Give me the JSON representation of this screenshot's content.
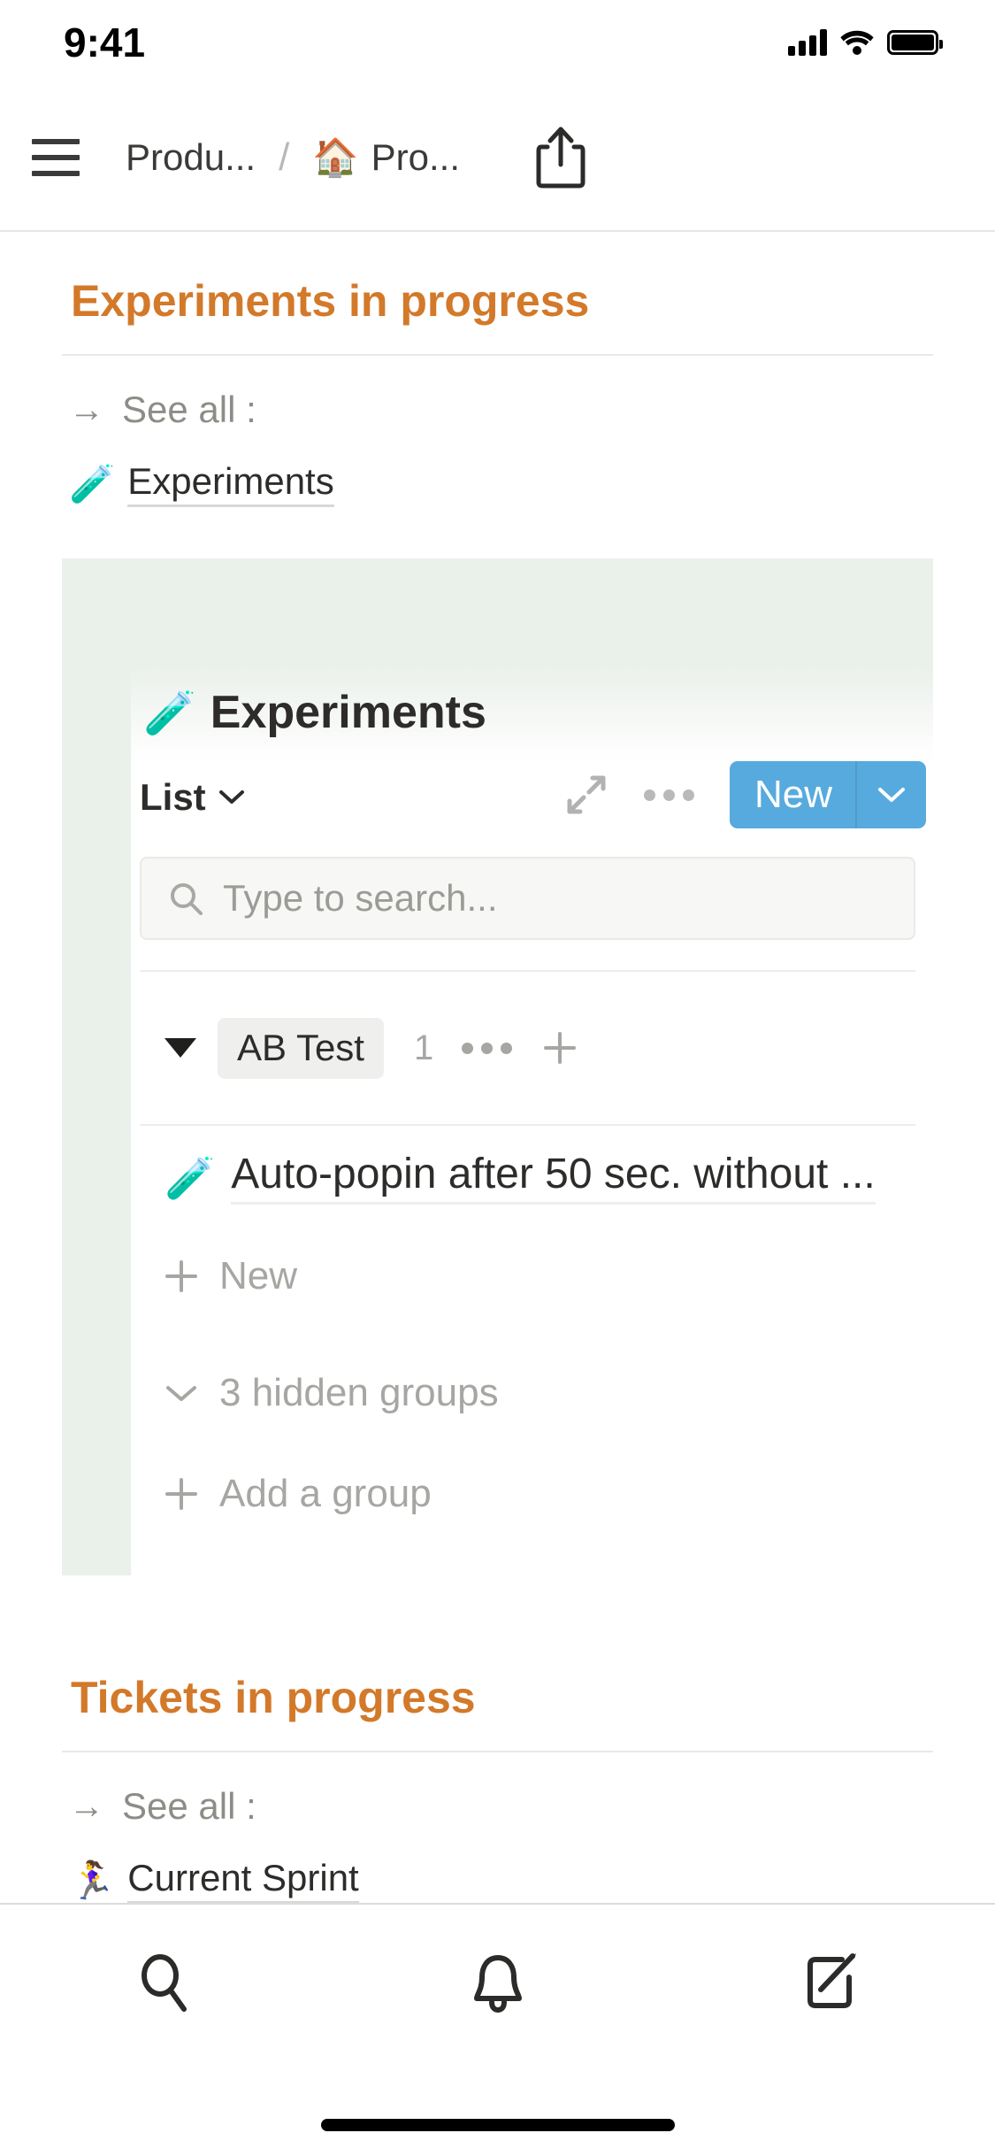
{
  "status_bar": {
    "time": "9:41",
    "signal_icon": "cellular-signal-icon",
    "wifi_icon": "wifi-icon",
    "battery_icon": "battery-full-icon"
  },
  "nav": {
    "menu_icon": "hamburger-menu-icon",
    "breadcrumb": {
      "parent": "Produ...",
      "separator": "/",
      "current_emoji": "🏠",
      "current": "Pro..."
    },
    "share_icon": "share-icon"
  },
  "sections": [
    {
      "title": "Experiments in progress",
      "see_all": {
        "arrow": "→",
        "label": "See all :"
      },
      "database_link": {
        "emoji": "🧪",
        "label": "Experiments"
      }
    },
    {
      "title": "Tickets in progress",
      "see_all": {
        "arrow": "→",
        "label": "See all :"
      },
      "database_link": {
        "emoji": "🏃‍♀️",
        "label": "Current Sprint"
      }
    }
  ],
  "embedded_database": {
    "title_emoji": "🧪",
    "title": "Experiments",
    "view": {
      "name": "List",
      "chevron_icon": "chevron-down-icon"
    },
    "toolbar": {
      "expand_icon": "expand-arrows-icon",
      "more_icon": "ellipsis-icon",
      "new_label": "New",
      "new_caret_icon": "chevron-down-icon",
      "new_button_color": "#57aadd"
    },
    "search": {
      "icon": "search-icon",
      "placeholder": "Type to search..."
    },
    "group": {
      "collapse_icon": "triangle-down-icon",
      "name": "AB Test",
      "count": "1",
      "more_icon": "ellipsis-icon",
      "add_icon": "plus-icon"
    },
    "rows": [
      {
        "emoji": "🧪",
        "title": "Auto-popin after 50 sec. without ..."
      }
    ],
    "new_row": {
      "icon": "plus-icon",
      "label": "New"
    },
    "hidden_groups": {
      "icon": "chevron-down-icon",
      "label": "3 hidden groups"
    },
    "add_group": {
      "icon": "plus-icon",
      "label": "Add a group"
    },
    "card_background": "#eaf0ea"
  },
  "bottom_bar": {
    "tabs": [
      {
        "icon": "search-icon",
        "name": "search-tab"
      },
      {
        "icon": "bell-icon",
        "name": "notifications-tab"
      },
      {
        "icon": "compose-icon",
        "name": "compose-tab"
      }
    ]
  },
  "theme": {
    "accent_orange": "#d3792a",
    "muted_gray": "#8d8d87"
  }
}
